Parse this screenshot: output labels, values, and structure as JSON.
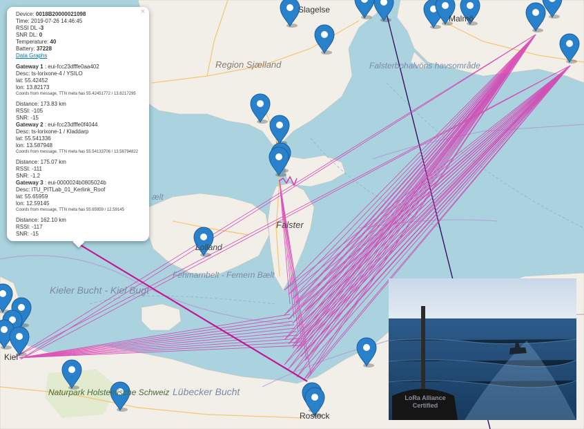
{
  "map": {
    "place_labels": {
      "region_sjaelland": "Region Sjælland",
      "falsterbohalvons": "Falsterbohalvöns havsområde",
      "falster": "Falster",
      "lolland": "Lolland",
      "fehmarnbelt": "Fehmarnbelt - Femern Bælt",
      "kieler_bucht": "Kieler Bucht - Kiel Bugt",
      "naturpark": "Naturpark Holsteinische Schweiz",
      "lubecker_bucht": "Lübecker Bucht",
      "rostock": "Rostock",
      "kiel": "Kiel",
      "slagelse": "Slagelse",
      "malmo": "Malmö",
      "belt": "ælt"
    },
    "marker_count": 24,
    "colors": {
      "water": "#aad3df",
      "land": "#f2efe9",
      "link_line": "#d63cb0",
      "dark_line": "#3a0a6a",
      "marker": "#2a81cb",
      "border": "#b59ad0"
    }
  },
  "popup": {
    "close": "×",
    "device_label": "Device:",
    "device_value": "0018B20000021098",
    "time": "Time: 2019-07-26 14:46:45",
    "rssi_dl_label": "RSSI DL",
    "rssi_dl_value": "-3",
    "snr_dl_label": "SNR DL:",
    "snr_dl_value": "0",
    "temperature_label": "Temperature:",
    "temperature_value": "40",
    "battery_label": "Battery:",
    "battery_value": "37228",
    "data_graphs_link": "Data Graphs",
    "gateways": [
      {
        "title": "Gateway 1",
        "id": ": eui-fcc23dfffe0aa402",
        "desc": "Desc: ts-lorixone-4 / YSILO",
        "lat": "lat: 55.42452",
        "lon": "lon: 13.82173",
        "coords_note": "Coords from message, TTN meta has 55.42451772 / 13.8217295",
        "distance": "Distance: 173.83 km",
        "rssi": "RSSI: -105",
        "snr": "SNR: -15"
      },
      {
        "title": "Gateway 2",
        "id": ": eui-fcc23dfffe0f4044",
        "desc": "Desc: ts-lorixone-1 / Kladdarp",
        "lat": "lat: 55.541336",
        "lon": "lon: 13.587948",
        "coords_note": "Coords from message, TTN meta has 55.54133706 / 13.58794822",
        "distance": "Distance: 175.07 km",
        "rssi": "RSSI: -111",
        "snr": "SNR: -1.2"
      },
      {
        "title": "Gateway 3",
        "id": ": eui-0000024b0805024b",
        "desc": "Desc: ITU_PITLab_01_Kerlink_Roof",
        "lat": "lat: 55.65959",
        "lon": "lon: 12.59145",
        "coords_note": "Coords from message, TTN meta has 55.65959 / 12.59145",
        "distance": "Distance: 162.10 km",
        "rssi": "RSSI: -117",
        "snr": "SNR: -15"
      }
    ]
  },
  "photo": {
    "sign_text": "LoRa Alliance Certified"
  }
}
